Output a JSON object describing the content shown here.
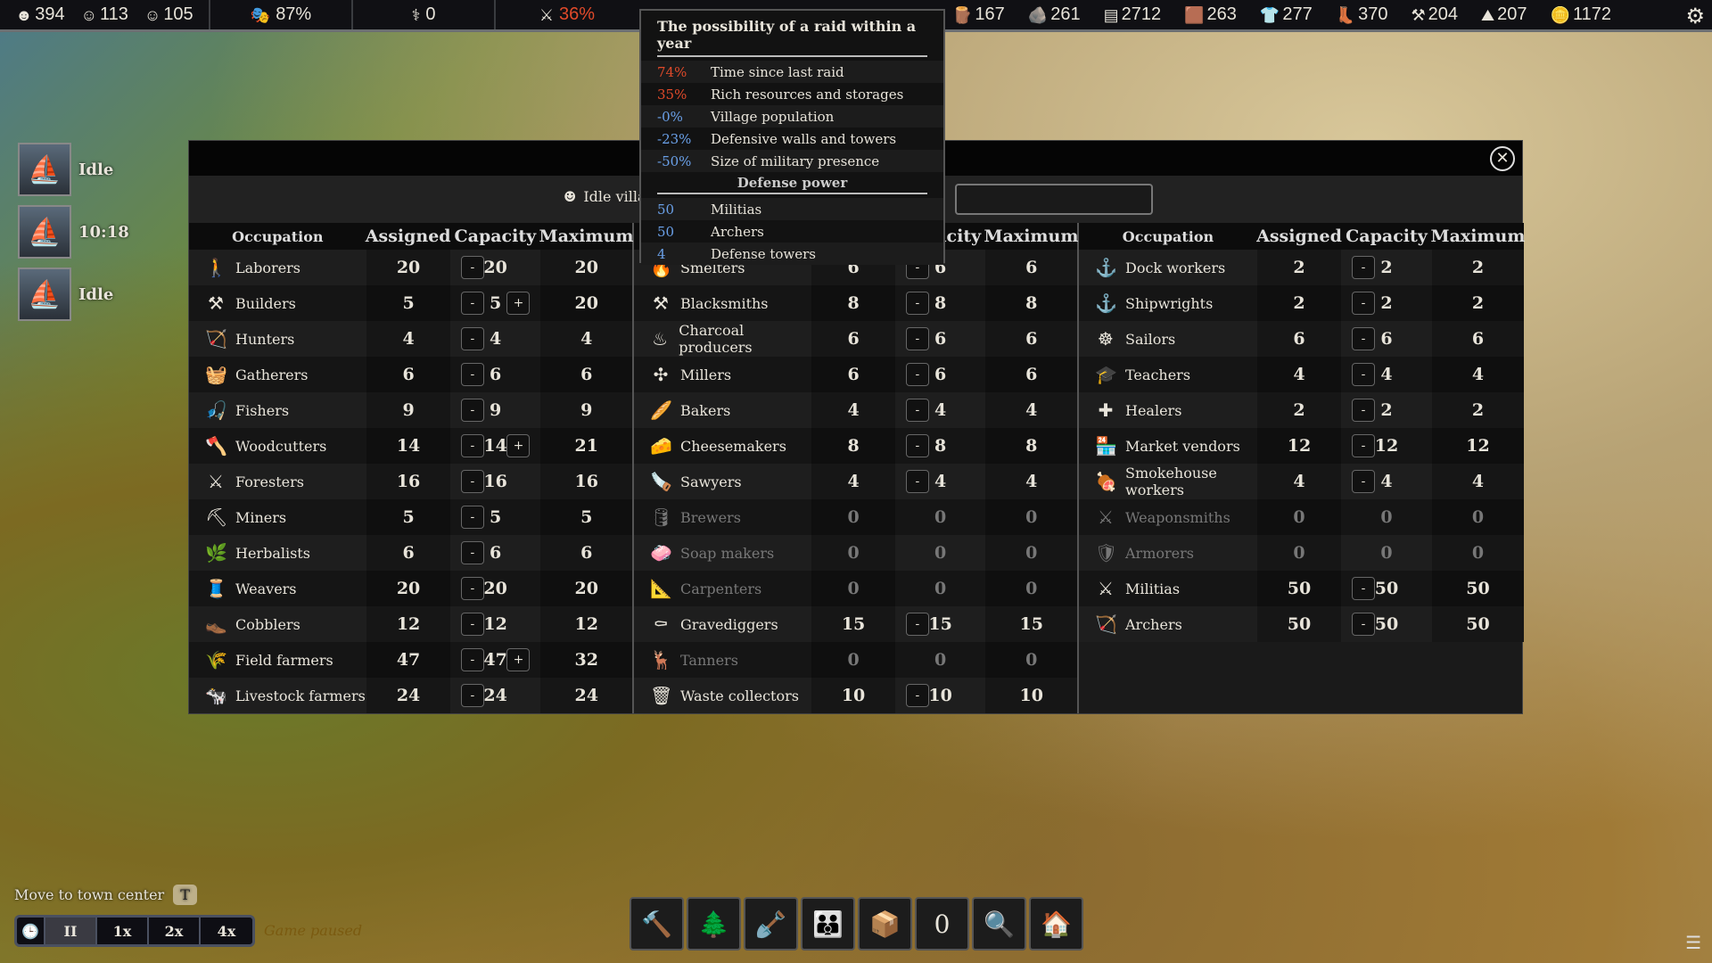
{
  "topbar": {
    "population": {
      "adults": "394",
      "children": "113",
      "elderly": "105"
    },
    "happiness": "87%",
    "health": "0",
    "raid_chance": "36%",
    "resources": [
      {
        "icon": "logs-icon",
        "value": "167"
      },
      {
        "icon": "stone-icon",
        "value": "261"
      },
      {
        "icon": "planks-icon",
        "value": "2712"
      },
      {
        "icon": "leather-icon",
        "value": "263"
      },
      {
        "icon": "clothes-icon",
        "value": "277"
      },
      {
        "icon": "boots-icon",
        "value": "370"
      },
      {
        "icon": "tools-icon",
        "value": "204"
      },
      {
        "icon": "ore-icon",
        "value": "207"
      },
      {
        "icon": "gold-icon",
        "value": "1172"
      }
    ],
    "raid_color": "#e04a2a"
  },
  "ships": [
    {
      "label": "Idle"
    },
    {
      "label": "10:18"
    },
    {
      "label": "Idle"
    }
  ],
  "panel": {
    "idle_label": "Idle villagers",
    "search_value": "",
    "headers": {
      "occupation": "Occupation",
      "assigned": "Assigned",
      "capacity": "Capacity",
      "maximum": "Maximum"
    },
    "tables": [
      [
        {
          "name": "Laborers",
          "icon": "🚶",
          "a": "20",
          "c": "20",
          "m": "20",
          "minus": true
        },
        {
          "name": "Builders",
          "icon": "⚒",
          "a": "5",
          "c": "5",
          "m": "20",
          "minus": true,
          "plus": true
        },
        {
          "name": "Hunters",
          "icon": "🏹",
          "a": "4",
          "c": "4",
          "m": "4",
          "minus": true
        },
        {
          "name": "Gatherers",
          "icon": "🧺",
          "a": "6",
          "c": "6",
          "m": "6",
          "minus": true
        },
        {
          "name": "Fishers",
          "icon": "🎣",
          "a": "9",
          "c": "9",
          "m": "9",
          "minus": true
        },
        {
          "name": "Woodcutters",
          "icon": "🪓",
          "a": "14",
          "c": "14",
          "m": "21",
          "minus": true,
          "plus": true
        },
        {
          "name": "Foresters",
          "icon": "⚔",
          "a": "16",
          "c": "16",
          "m": "16",
          "minus": true
        },
        {
          "name": "Miners",
          "icon": "⛏",
          "a": "5",
          "c": "5",
          "m": "5",
          "minus": true
        },
        {
          "name": "Herbalists",
          "icon": "🌿",
          "a": "6",
          "c": "6",
          "m": "6",
          "minus": true
        },
        {
          "name": "Weavers",
          "icon": "🧵",
          "a": "20",
          "c": "20",
          "m": "20",
          "minus": true
        },
        {
          "name": "Cobblers",
          "icon": "👞",
          "a": "12",
          "c": "12",
          "m": "12",
          "minus": true
        },
        {
          "name": "Field farmers",
          "icon": "🌾",
          "a": "47",
          "c": "47",
          "m": "32",
          "minus": true,
          "plus": true
        },
        {
          "name": "Livestock farmers",
          "icon": "🐄",
          "a": "24",
          "c": "24",
          "m": "24",
          "minus": true
        }
      ],
      [
        {
          "name": "Smelters",
          "icon": "🔥",
          "a": "6",
          "c": "6",
          "m": "6",
          "minus": true
        },
        {
          "name": "Blacksmiths",
          "icon": "⚒",
          "a": "8",
          "c": "8",
          "m": "8",
          "minus": true
        },
        {
          "name": "Charcoal producers",
          "icon": "♨",
          "a": "6",
          "c": "6",
          "m": "6",
          "minus": true
        },
        {
          "name": "Millers",
          "icon": "✣",
          "a": "6",
          "c": "6",
          "m": "6",
          "minus": true
        },
        {
          "name": "Bakers",
          "icon": "🥖",
          "a": "4",
          "c": "4",
          "m": "4",
          "minus": true
        },
        {
          "name": "Cheesemakers",
          "icon": "🧀",
          "a": "8",
          "c": "8",
          "m": "8",
          "minus": true
        },
        {
          "name": "Sawyers",
          "icon": "🪚",
          "a": "4",
          "c": "4",
          "m": "4",
          "minus": true
        },
        {
          "name": "Brewers",
          "icon": "🛢",
          "a": "0",
          "c": "0",
          "m": "0",
          "off": true
        },
        {
          "name": "Soap makers",
          "icon": "🧼",
          "a": "0",
          "c": "0",
          "m": "0",
          "off": true
        },
        {
          "name": "Carpenters",
          "icon": "📐",
          "a": "0",
          "c": "0",
          "m": "0",
          "off": true
        },
        {
          "name": "Gravediggers",
          "icon": "⚰",
          "a": "15",
          "c": "15",
          "m": "15",
          "minus": true
        },
        {
          "name": "Tanners",
          "icon": "🦌",
          "a": "0",
          "c": "0",
          "m": "0",
          "off": true
        },
        {
          "name": "Waste collectors",
          "icon": "🗑",
          "a": "10",
          "c": "10",
          "m": "10",
          "minus": true
        }
      ],
      [
        {
          "name": "Dock workers",
          "icon": "⚓",
          "a": "2",
          "c": "2",
          "m": "2",
          "minus": true
        },
        {
          "name": "Shipwrights",
          "icon": "⚓",
          "a": "2",
          "c": "2",
          "m": "2",
          "minus": true
        },
        {
          "name": "Sailors",
          "icon": "☸",
          "a": "6",
          "c": "6",
          "m": "6",
          "minus": true
        },
        {
          "name": "Teachers",
          "icon": "🎓",
          "a": "4",
          "c": "4",
          "m": "4",
          "minus": true
        },
        {
          "name": "Healers",
          "icon": "✚",
          "a": "2",
          "c": "2",
          "m": "2",
          "minus": true
        },
        {
          "name": "Market vendors",
          "icon": "🏪",
          "a": "12",
          "c": "12",
          "m": "12",
          "minus": true
        },
        {
          "name": "Smokehouse workers",
          "icon": "🍖",
          "a": "4",
          "c": "4",
          "m": "4",
          "minus": true
        },
        {
          "name": "Weaponsmiths",
          "icon": "⚔",
          "a": "0",
          "c": "0",
          "m": "0",
          "off": true
        },
        {
          "name": "Armorers",
          "icon": "🛡",
          "a": "0",
          "c": "0",
          "m": "0",
          "off": true
        },
        {
          "name": "Militias",
          "icon": "⚔",
          "a": "50",
          "c": "50",
          "m": "50",
          "minus": true
        },
        {
          "name": "Archers",
          "icon": "🏹",
          "a": "50",
          "c": "50",
          "m": "50",
          "minus": true
        }
      ]
    ]
  },
  "tooltip": {
    "title": "The possibility of a raid within a year",
    "factors": [
      {
        "v": "74%",
        "t": "Time since last raid",
        "color": "red"
      },
      {
        "v": "35%",
        "t": "Rich resources and storages",
        "color": "red"
      },
      {
        "v": "-0%",
        "t": "Village population",
        "color": "blue"
      },
      {
        "v": "-23%",
        "t": "Defensive walls and towers",
        "color": "blue"
      },
      {
        "v": "-50%",
        "t": "Size of military presence",
        "color": "blue"
      }
    ],
    "defense_title": "Defense power",
    "defense": [
      {
        "v": "50",
        "t": "Militias"
      },
      {
        "v": "50",
        "t": "Archers"
      },
      {
        "v": "4",
        "t": "Defense towers"
      }
    ]
  },
  "hint": {
    "text": "Move to town center",
    "key": "T"
  },
  "speed": {
    "pause": "II",
    "x1": "1x",
    "x2": "2x",
    "x4": "4x",
    "status": "Game paused"
  },
  "bottom_toolbar": [
    {
      "icon": "build-icon",
      "g": "🔨"
    },
    {
      "icon": "nature-icon",
      "g": "🌲"
    },
    {
      "icon": "shovel-icon",
      "g": "🪏"
    },
    {
      "icon": "villagers-icon",
      "g": "👪"
    },
    {
      "icon": "storage-icon",
      "g": "📦"
    },
    {
      "icon": "counter-icon",
      "g": "0"
    },
    {
      "icon": "find-villager-icon",
      "g": "🔍"
    },
    {
      "icon": "find-building-icon",
      "g": "🏠"
    }
  ]
}
